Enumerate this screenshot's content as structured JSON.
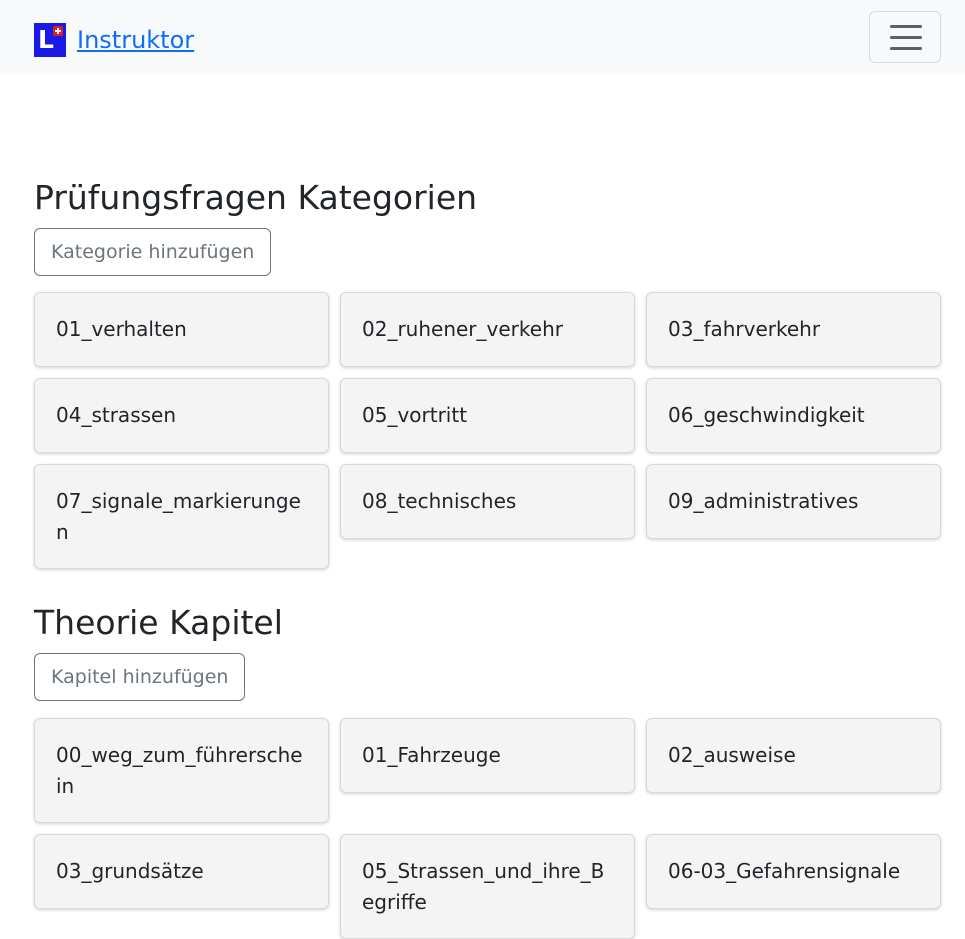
{
  "navbar": {
    "brand_logo_letter": "L",
    "brand_name": "Instruktor",
    "logo_color": "#1a1ae6",
    "link_color": "#0d6efd"
  },
  "categories": {
    "title": "Prüfungsfragen Kategorien",
    "add_label": "Kategorie hinzufügen",
    "items": [
      "01_verhalten",
      "02_ruhener_verkehr",
      "03_fahrverkehr",
      "04_strassen",
      "05_vortritt",
      "06_geschwindigkeit",
      "07_signale_markierungen",
      "08_technisches",
      "09_administratives"
    ]
  },
  "chapters": {
    "title": "Theorie Kapitel",
    "add_label": "Kapitel hinzufügen",
    "items": [
      "00_weg_zum_führerschein",
      "01_Fahrzeuge",
      "02_ausweise",
      "03_grundsätze",
      "05_Strassen_und_ihre_Begriffe",
      "06-03_Gefahrensignale"
    ]
  }
}
